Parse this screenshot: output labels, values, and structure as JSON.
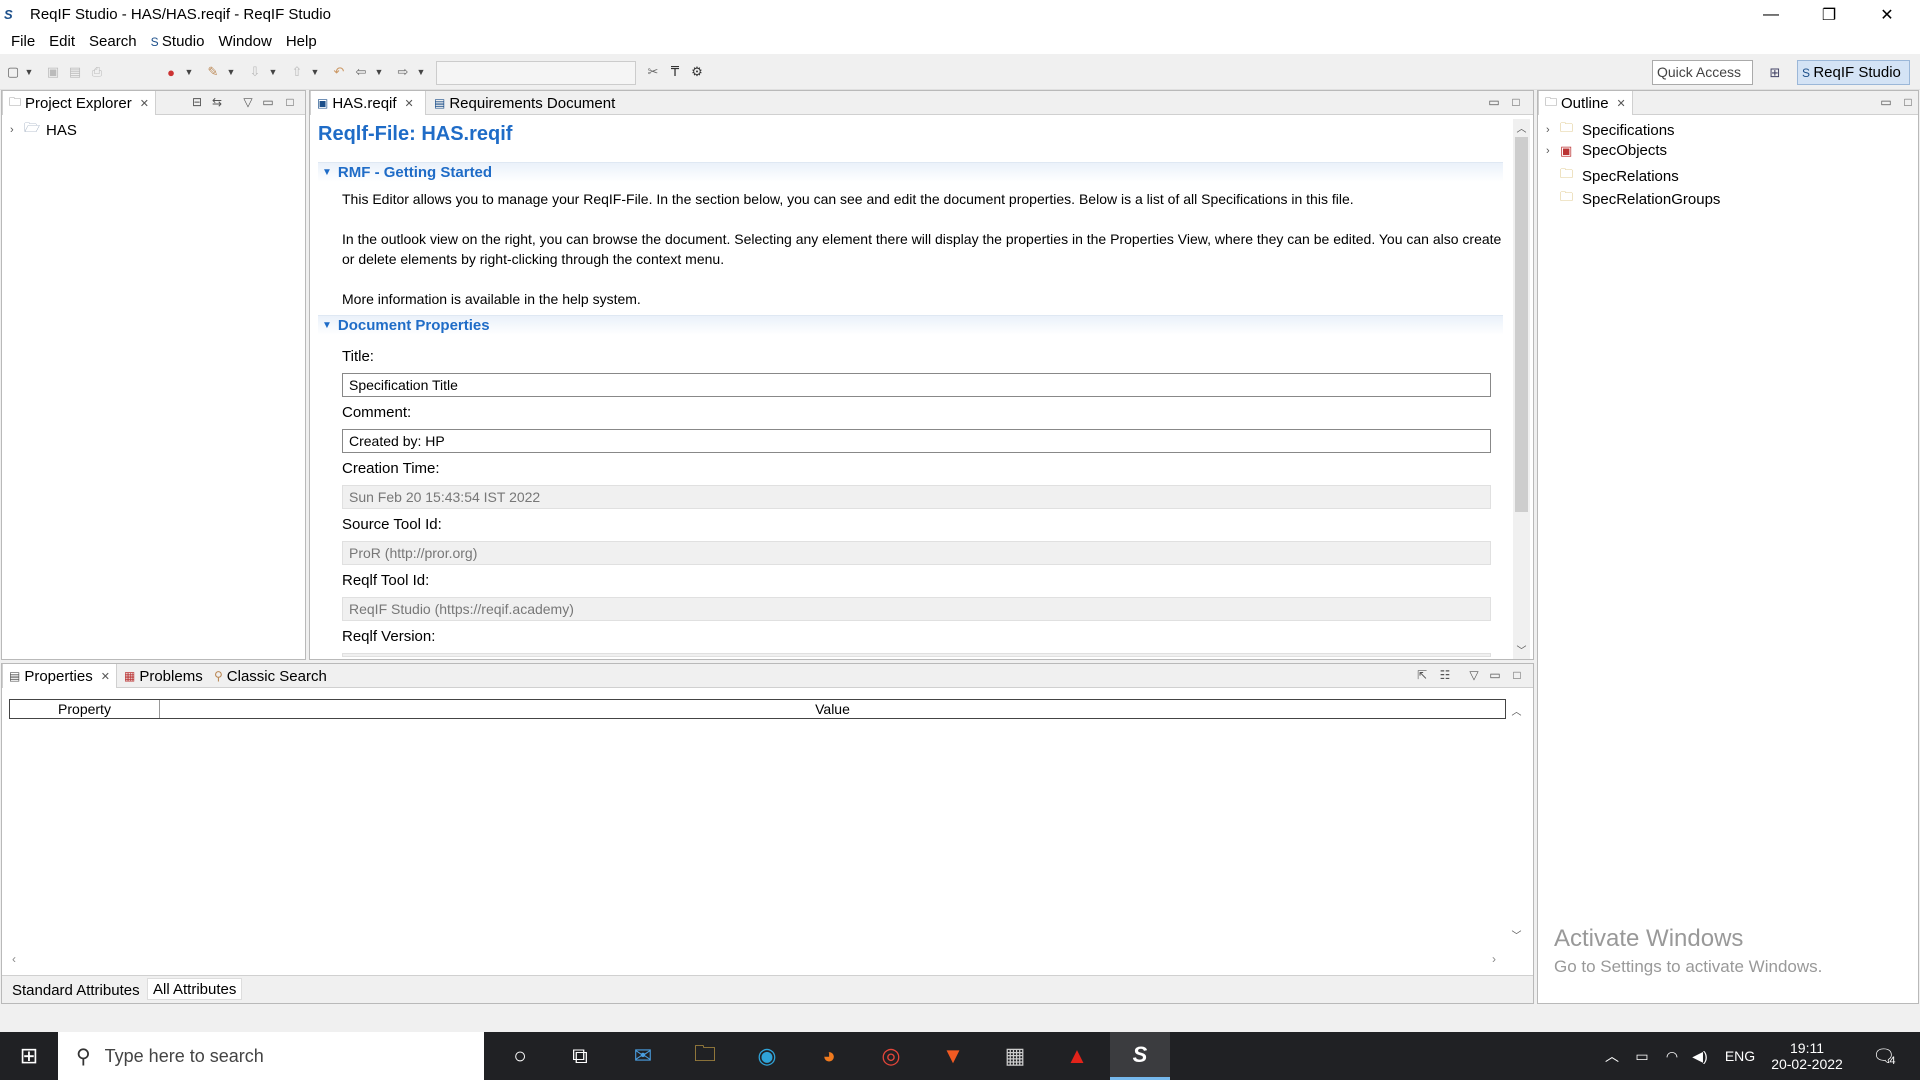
{
  "window": {
    "title": "ReqIF Studio - HAS/HAS.reqif - ReqIF Studio",
    "minimize": "—",
    "restore": "❐",
    "close": "✕"
  },
  "menu": [
    "File",
    "Edit",
    "Search",
    "Studio",
    "Window",
    "Help"
  ],
  "toolbar": {
    "quick_access": "Quick Access",
    "perspective_label": "ReqIF Studio"
  },
  "project_explorer": {
    "tab_label": "Project Explorer",
    "items": [
      {
        "label": "HAS"
      }
    ]
  },
  "editor": {
    "tabs": [
      {
        "label": "HAS.reqif"
      },
      {
        "label": "Requirements Document"
      }
    ],
    "title": "Reqlf-File: HAS.reqif",
    "getting_started": {
      "heading": "RMF - Getting Started",
      "p1": "This Editor allows you to manage your ReqIF-File.  In the section below, you can see and edit the document properties.  Below is a list of all Specifications in this file.",
      "p2": "In the outlook view on the right, you can browse the document.  Selecting any element there will display the properties in the Properties View, where they can be edited.  You can also create or delete elements by right-clicking through the context menu.",
      "p3": "More information is available in the help system."
    },
    "document_properties": {
      "heading": "Document Properties",
      "fields": [
        {
          "label": "Title:",
          "value": "Specification Title",
          "readonly": false
        },
        {
          "label": "Comment:",
          "value": "Created by: HP",
          "readonly": false
        },
        {
          "label": "Creation Time:",
          "value": "Sun Feb 20 15:43:54 IST 2022",
          "readonly": true
        },
        {
          "label": "Source Tool Id:",
          "value": "ProR (http://pror.org)",
          "readonly": true
        },
        {
          "label": "Reqlf Tool Id:",
          "value": "ReqIF Studio (https://reqif.academy)",
          "readonly": true
        },
        {
          "label": "Reqlf Version:",
          "value": "",
          "readonly": true
        }
      ]
    }
  },
  "outline": {
    "tab_label": "Outline",
    "items": [
      {
        "label": "Specifications",
        "expandable": true
      },
      {
        "label": "SpecObjects",
        "expandable": true
      },
      {
        "label": "SpecRelations",
        "expandable": false
      },
      {
        "label": "SpecRelationGroups",
        "expandable": false
      }
    ]
  },
  "bottom_panel": {
    "tabs": [
      {
        "label": "Properties"
      },
      {
        "label": "Problems"
      },
      {
        "label": "Classic Search"
      }
    ],
    "columns": [
      "Property",
      "Value"
    ],
    "bottom_tabs": [
      {
        "label": "Standard Attributes"
      },
      {
        "label": "All Attributes"
      }
    ]
  },
  "watermark": {
    "line1": "Activate Windows",
    "line2": "Go to Settings to activate Windows."
  },
  "taskbar": {
    "search_placeholder": "Type here to search",
    "language": "ENG",
    "time": "19:11",
    "date": "20-02-2022",
    "notifications": "4"
  },
  "colors": {
    "link_blue": "#1f6cc7",
    "taskbar": "#202124",
    "active_perspective": "#d4e3f5"
  }
}
